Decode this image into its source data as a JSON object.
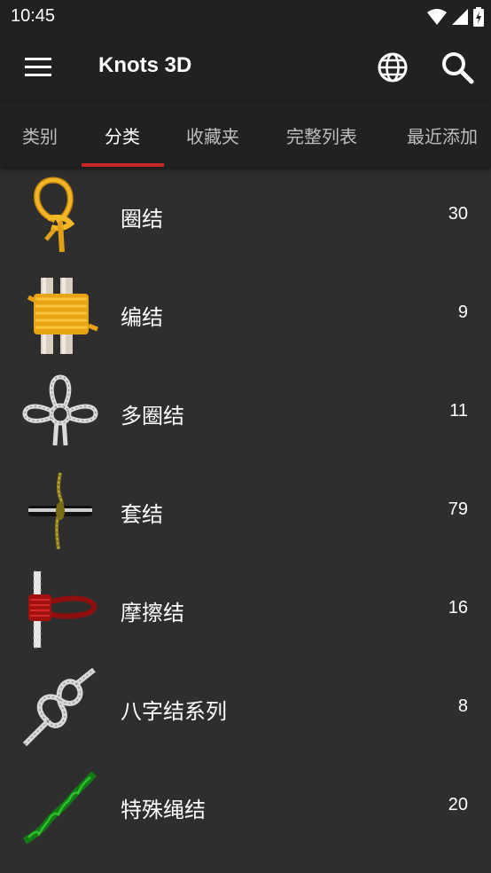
{
  "status_bar": {
    "time": "10:45",
    "icons": [
      "wifi-icon",
      "signal-icon",
      "battery-icon"
    ]
  },
  "app_bar": {
    "title": "Knots 3D",
    "icons": [
      "menu-icon",
      "globe-icon",
      "search-icon"
    ]
  },
  "tabs": [
    {
      "label": "类别",
      "active": false
    },
    {
      "label": "分类",
      "active": true
    },
    {
      "label": "收藏夹",
      "active": false
    },
    {
      "label": "完整列表",
      "active": false
    },
    {
      "label": "最近添加",
      "active": false
    }
  ],
  "colors": {
    "background": "#2e2e2e",
    "bar": "#212121",
    "tab_indicator": "#c62828",
    "text": "#ffffff",
    "tab_inactive": "#bdbdbd"
  },
  "categories": [
    {
      "name": "圈结",
      "count": "30",
      "icon": "loop-knot-icon"
    },
    {
      "name": "编结",
      "count": "9",
      "icon": "lashing-knot-icon"
    },
    {
      "name": "多圈结",
      "count": "11",
      "icon": "multi-loop-knot-icon"
    },
    {
      "name": "套结",
      "count": "79",
      "icon": "hitch-knot-icon"
    },
    {
      "name": "摩擦结",
      "count": "16",
      "icon": "friction-knot-icon"
    },
    {
      "name": "八字结系列",
      "count": "8",
      "icon": "figure-eight-knot-icon"
    },
    {
      "name": "特殊绳结",
      "count": "20",
      "icon": "special-knot-icon"
    }
  ]
}
